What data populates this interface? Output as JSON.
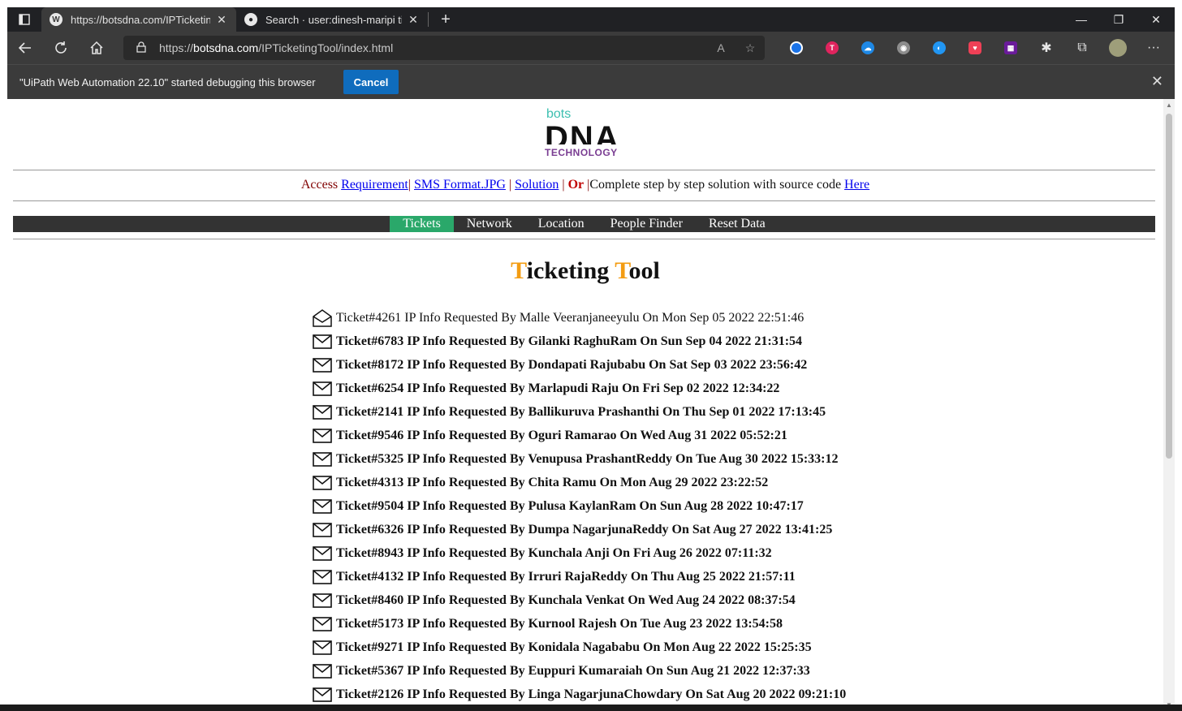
{
  "browser": {
    "tabs": [
      {
        "title": "https://botsdna.com/IPTicketing",
        "favicon": "wordpress-icon",
        "active": true
      },
      {
        "title": "Search · user:dinesh-maripi ticke",
        "favicon": "github-icon",
        "active": false
      }
    ],
    "url_prefix": "https://",
    "url_host": "botsdna.com",
    "url_path": "/IPTicketingTool/index.html",
    "read_aloud_label": "A",
    "extensions": [
      "ext-blue-icon",
      "ext-red-t-icon",
      "ext-cloud-icon",
      "ext-owl-icon",
      "ext-circle-icon",
      "pocket-icon",
      "ext-grid-icon",
      "extensions-puzzle-icon",
      "collections-icon",
      "profile-avatar",
      "more-icon"
    ]
  },
  "debug_bar": {
    "message": "\"UiPath Web Automation 22.10\" started debugging this browser",
    "cancel_label": "Cancel"
  },
  "logo": {
    "bots": "bots",
    "dna": "DNA",
    "technology": "TECHNOLOGY"
  },
  "access": {
    "prefix": "Access ",
    "requirement": "Requirement",
    "sep1": "| ",
    "sms": "SMS Format.JPG",
    "sep2": " | ",
    "solution": "Solution",
    "sep3": " | ",
    "or": "Or",
    "sep4": " |",
    "complete": "Complete step by step solution with source code ",
    "here": "Here"
  },
  "menu": [
    {
      "label": "Tickets",
      "active": true
    },
    {
      "label": "Network",
      "active": false
    },
    {
      "label": "Location",
      "active": false
    },
    {
      "label": "People Finder",
      "active": false
    },
    {
      "label": "Reset Data",
      "active": false
    }
  ],
  "heading": {
    "t1": "T",
    "rest1": "icketing ",
    "t2": "T",
    "rest2": "ool"
  },
  "tickets": [
    {
      "text": "Ticket#4261 IP Info Requested By Malle Veeranjaneeyulu On Mon Sep 05 2022 22:51:46",
      "read": true
    },
    {
      "text": "Ticket#6783 IP Info Requested By Gilanki RaghuRam On Sun Sep 04 2022 21:31:54",
      "read": false
    },
    {
      "text": "Ticket#8172 IP Info Requested By Dondapati Rajubabu On Sat Sep 03 2022 23:56:42",
      "read": false
    },
    {
      "text": "Ticket#6254 IP Info Requested By Marlapudi Raju On Fri Sep 02 2022 12:34:22",
      "read": false
    },
    {
      "text": "Ticket#2141 IP Info Requested By Ballikuruva Prashanthi On Thu Sep 01 2022 17:13:45",
      "read": false
    },
    {
      "text": "Ticket#9546 IP Info Requested By Oguri Ramarao On Wed Aug 31 2022 05:52:21",
      "read": false
    },
    {
      "text": "Ticket#5325 IP Info Requested By Venupusa PrashantReddy On Tue Aug 30 2022 15:33:12",
      "read": false
    },
    {
      "text": "Ticket#4313 IP Info Requested By Chita Ramu On Mon Aug 29 2022 23:22:52",
      "read": false
    },
    {
      "text": "Ticket#9504 IP Info Requested By Pulusa KaylanRam On Sun Aug 28 2022 10:47:17",
      "read": false
    },
    {
      "text": "Ticket#6326 IP Info Requested By Dumpa NagarjunaReddy On Sat Aug 27 2022 13:41:25",
      "read": false
    },
    {
      "text": "Ticket#8943 IP Info Requested By Kunchala Anji On Fri Aug 26 2022 07:11:32",
      "read": false
    },
    {
      "text": "Ticket#4132 IP Info Requested By Irruri RajaReddy On Thu Aug 25 2022 21:57:11",
      "read": false
    },
    {
      "text": "Ticket#8460 IP Info Requested By Kunchala Venkat On Wed Aug 24 2022 08:37:54",
      "read": false
    },
    {
      "text": "Ticket#5173 IP Info Requested By Kurnool Rajesh On Tue Aug 23 2022 13:54:58",
      "read": false
    },
    {
      "text": "Ticket#9271 IP Info Requested By Konidala Nagababu On Mon Aug 22 2022 15:25:35",
      "read": false
    },
    {
      "text": "Ticket#5367 IP Info Requested By Euppuri Kumaraiah On Sun Aug 21 2022 12:37:33",
      "read": false
    },
    {
      "text": "Ticket#2126 IP Info Requested By Linga NagarjunaChowdary On Sat Aug 20 2022 09:21:10",
      "read": false
    }
  ],
  "colors": {
    "menu_active": "#2aa86a",
    "heading_accent": "#f39c12",
    "link": "#0000ee",
    "access_text": "#800000"
  }
}
